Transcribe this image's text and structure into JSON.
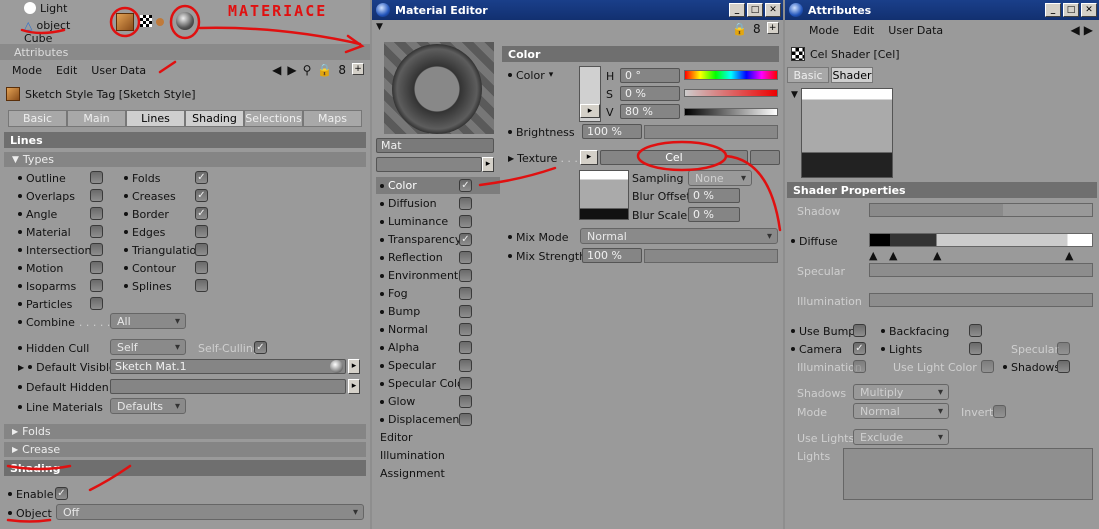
{
  "left": {
    "objects": {
      "light": "Light",
      "object": "object",
      "cube": "Cube"
    },
    "attributes_title": "Attributes",
    "menu": [
      "Mode",
      "Edit",
      "User Data"
    ],
    "tag_title": "Sketch Style Tag [Sketch Style]",
    "tabs": [
      "Basic",
      "Main",
      "Lines",
      "Shading",
      "Selections",
      "Maps"
    ],
    "active_tabs": [
      "Lines",
      "Shading"
    ],
    "section_lines": "Lines",
    "types_label": "Types",
    "types_left": [
      "Outline",
      "Overlaps",
      "Angle",
      "Material",
      "Intersections",
      "Motion",
      "Isoparms",
      "Particles"
    ],
    "types_right": [
      "Folds",
      "Creases",
      "Border",
      "Edges",
      "Triangulation",
      "Contour",
      "Splines"
    ],
    "checked_right": [
      true,
      true,
      true,
      false,
      false,
      false,
      false
    ],
    "combine_label": "Combine",
    "combine_value": "All",
    "hidden_cull_label": "Hidden Cull",
    "hidden_cull_value": "Self",
    "self_culling_label": "Self-Culling",
    "default_visible_label": "Default Visible",
    "default_visible_value": "Sketch Mat.1",
    "default_hidden_label": "Default Hidden",
    "line_materials_label": "Line Materials",
    "line_materials_value": "Defaults",
    "folds_label": "Folds",
    "crease_label": "Crease",
    "section_shading": "Shading",
    "enable_label": "Enable",
    "object_label": "Object",
    "object_value": "Off",
    "annotation_text": "MATERIACE"
  },
  "mid": {
    "title": "Material Editor",
    "mat_name": "Mat",
    "channels": [
      "Color",
      "Diffusion",
      "Luminance",
      "Transparency",
      "Reflection",
      "Environment",
      "Fog",
      "Bump",
      "Normal",
      "Alpha",
      "Specular",
      "Specular Color",
      "Glow",
      "Displacement",
      "Editor",
      "Illumination",
      "Assignment"
    ],
    "checked_channels": [
      "Color",
      "Transparency"
    ],
    "section_color": "Color",
    "color_label": "Color",
    "h_label": "H",
    "h_value": "0 °",
    "s_label": "S",
    "s_value": "0 %",
    "v_label": "V",
    "v_value": "80 %",
    "brightness_label": "Brightness",
    "brightness_value": "100 %",
    "texture_label": "Texture",
    "texture_value": "Cel",
    "sampling_label": "Sampling",
    "sampling_value": "None",
    "blur_offset_label": "Blur Offset",
    "blur_offset_value": "0 %",
    "blur_scale_label": "Blur Scale",
    "blur_scale_value": "0 %",
    "mix_mode_label": "Mix Mode",
    "mix_mode_value": "Normal",
    "mix_strength_label": "Mix Strength",
    "mix_strength_value": "100 %"
  },
  "right": {
    "title": "Attributes",
    "menu": [
      "Mode",
      "Edit",
      "User Data"
    ],
    "shader_title": "Cel Shader [Cel]",
    "tabs": [
      "Basic",
      "Shader"
    ],
    "section": "Shader Properties",
    "shadow_label": "Shadow",
    "diffuse_label": "Diffuse",
    "specular_label": "Specular",
    "illumination_label": "Illumination",
    "use_bump": "Use Bump",
    "backfacing": "Backfacing",
    "camera": "Camera",
    "lights": "Lights",
    "specular_cb": "Specular",
    "illumination_cb": "Illumination",
    "use_light_color": "Use Light Color",
    "shadows_cb": "Shadows",
    "shadows_label": "Shadows",
    "shadows_value": "Multiply",
    "mode_label": "Mode",
    "mode_value": "Normal",
    "invert_label": "Invert",
    "use_lights_label": "Use Lights",
    "use_lights_value": "Exclude",
    "lights_label": "Lights"
  }
}
